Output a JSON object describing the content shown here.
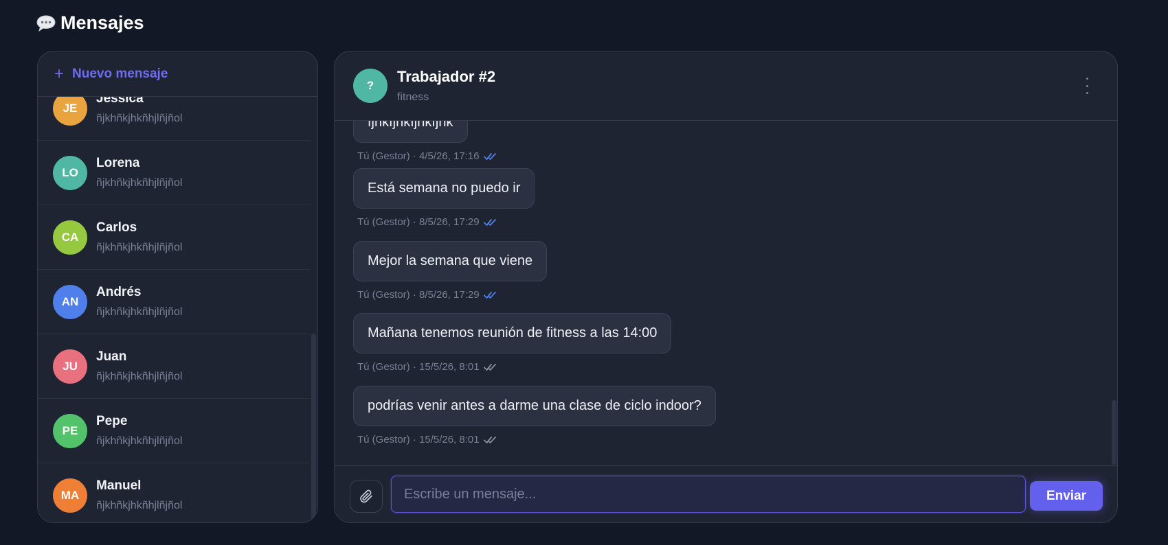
{
  "page": {
    "title": "Mensajes",
    "title_icon": "speech-bubble-icon"
  },
  "sidebar": {
    "new_message_label": "Nuevo mensaje",
    "new_message_icon": "plus-icon",
    "contacts": [
      {
        "initials": "JE",
        "name": "Jessica",
        "preview": "ñjkhñkjhkñhjlñjñol",
        "color": "#e9a43f"
      },
      {
        "initials": "LO",
        "name": "Lorena",
        "preview": "ñjkhñkjhkñhjlñjñol",
        "color": "#4fb7a4"
      },
      {
        "initials": "CA",
        "name": "Carlos",
        "preview": "ñjkhñkjhkñhjlñjñol",
        "color": "#96c93f"
      },
      {
        "initials": "AN",
        "name": "Andrés",
        "preview": "ñjkhñkjhkñhjlñjñol",
        "color": "#4f7fea"
      },
      {
        "initials": "JU",
        "name": "Juan",
        "preview": "ñjkhñkjhkñhjlñjñol",
        "color": "#e8707f"
      },
      {
        "initials": "PE",
        "name": "Pepe",
        "preview": "ñjkhñkjhkñhjlñjñol",
        "color": "#52c26b"
      },
      {
        "initials": "MA",
        "name": "Manuel",
        "preview": "ñjkhñkjhkñhjlñjñol",
        "color": "#ee7f34"
      }
    ]
  },
  "chat": {
    "avatar_initials": "?",
    "name": "Trabajador #2",
    "subtitle": "fitness",
    "menu_icon": "more-vertical-icon",
    "messages": [
      {
        "text": "fjhkfjhkfjhkfjhk",
        "meta": "Tú (Gestor) · 4/5/26, 17:16",
        "read": true
      },
      {
        "text": "Está semana no puedo ir",
        "meta": "Tú (Gestor) · 8/5/26, 17:29",
        "read": true
      },
      {
        "text": "Mejor la semana que viene",
        "meta": "Tú (Gestor) · 8/5/26, 17:29",
        "read": true
      },
      {
        "text": "Mañana tenemos reunión de fitness a las 14:00",
        "meta": "Tú (Gestor) · 15/5/26, 8:01",
        "read": false
      },
      {
        "text": "podrías venir antes a darme una clase de ciclo indoor?",
        "meta": "Tú (Gestor) · 15/5/26, 8:01",
        "read": false
      }
    ],
    "colors": {
      "read_check": "#4f7fea",
      "sent_check": "#8a8fa0"
    }
  },
  "composer": {
    "attach_icon": "paperclip-icon",
    "placeholder": "Escribe un mensaje...",
    "value": "",
    "send_label": "Enviar"
  }
}
